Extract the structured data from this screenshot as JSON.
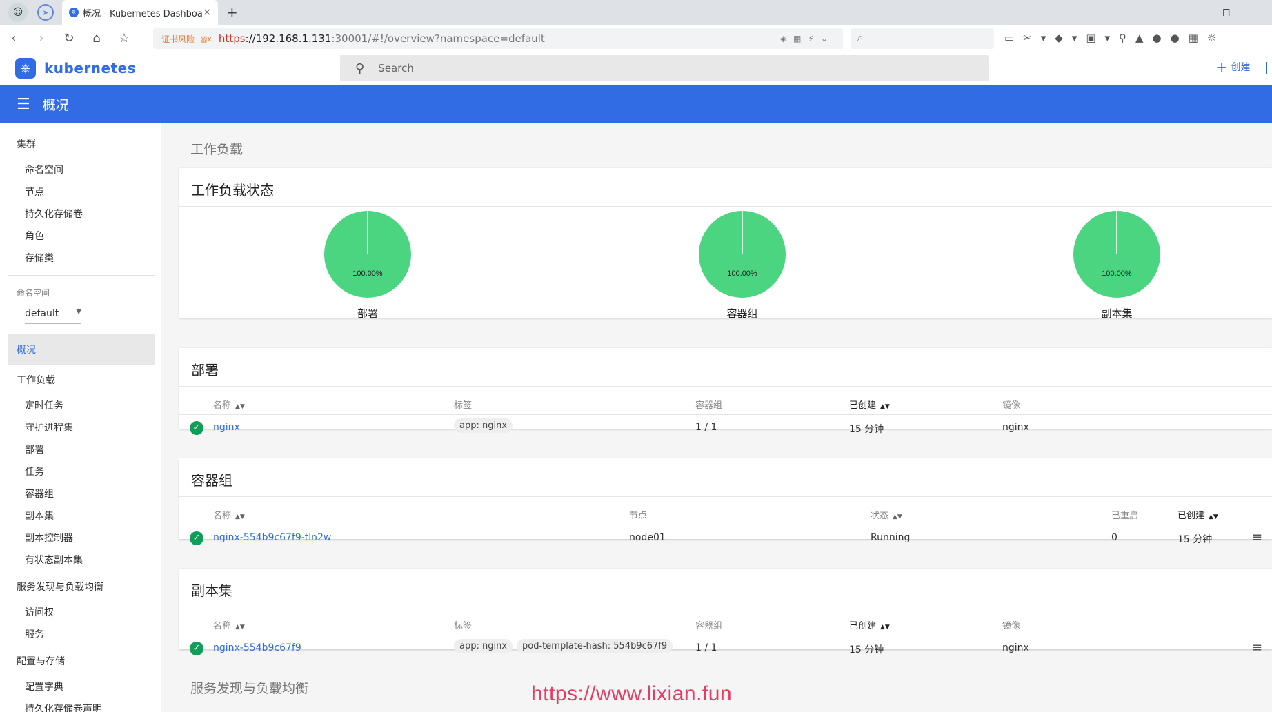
{
  "browser": {
    "tab_title": "概况 - Kubernetes Dashboard",
    "tab_close": "×",
    "new_tab": "+",
    "cert_warning": "证书风险",
    "url_scheme": "https",
    "url_host": "://192.168.1.131",
    "url_rest": ":30001/#!/overview?namespace=default"
  },
  "header": {
    "logo_text": "kubernetes",
    "search_placeholder": "Search",
    "create_label": "创建"
  },
  "toolbar": {
    "page_title": "概况"
  },
  "sidebar": {
    "cluster": "集群",
    "cluster_items": [
      "命名空间",
      "节点",
      "持久化存储卷",
      "角色",
      "存储类"
    ],
    "namespace_label": "命名空间",
    "namespace_value": "default",
    "overview": "概况",
    "workloads": "工作负载",
    "workload_items": [
      "定时任务",
      "守护进程集",
      "部署",
      "任务",
      "容器组",
      "副本集",
      "副本控制器",
      "有状态副本集"
    ],
    "discovery": "服务发现与负载均衡",
    "discovery_items": [
      "访问权",
      "服务"
    ],
    "config": "配置与存储",
    "config_items": [
      "配置字典",
      "持久化存储卷声明"
    ]
  },
  "main": {
    "workloads_section": "工作负载",
    "status_card": {
      "title": "工作负载状态",
      "pies": [
        {
          "label": "部署",
          "percent_text": "100.00%",
          "fraction": 1.0
        },
        {
          "label": "容器组",
          "percent_text": "100.00%",
          "fraction": 1.0
        },
        {
          "label": "副本集",
          "percent_text": "100.00%",
          "fraction": 1.0
        }
      ],
      "color": "#4cd581"
    },
    "deployments": {
      "title": "部署",
      "headers": {
        "name": "名称",
        "labels": "标签",
        "pods": "容器组",
        "created": "已创建",
        "image": "镜像"
      },
      "rows": [
        {
          "name": "nginx",
          "labels": [
            "app: nginx"
          ],
          "pods": "1 / 1",
          "created": "15 分钟",
          "image": "nginx"
        }
      ]
    },
    "pods": {
      "title": "容器组",
      "headers": {
        "name": "名称",
        "node": "节点",
        "status": "状态",
        "restarts": "已重启",
        "created": "已创建"
      },
      "rows": [
        {
          "name": "nginx-554b9c67f9-tln2w",
          "node": "node01",
          "status": "Running",
          "restarts": "0",
          "created": "15 分钟"
        }
      ]
    },
    "replicasets": {
      "title": "副本集",
      "headers": {
        "name": "名称",
        "labels": "标签",
        "pods": "容器组",
        "created": "已创建",
        "image": "镜像"
      },
      "rows": [
        {
          "name": "nginx-554b9c67f9",
          "labels": [
            "app: nginx",
            "pod-template-hash: 554b9c67f9"
          ],
          "pods": "1 / 1",
          "created": "15 分钟",
          "image": "nginx"
        }
      ]
    },
    "discovery_section": "服务发现与负载均衡"
  },
  "watermark": "https://www.lixian.fun"
}
